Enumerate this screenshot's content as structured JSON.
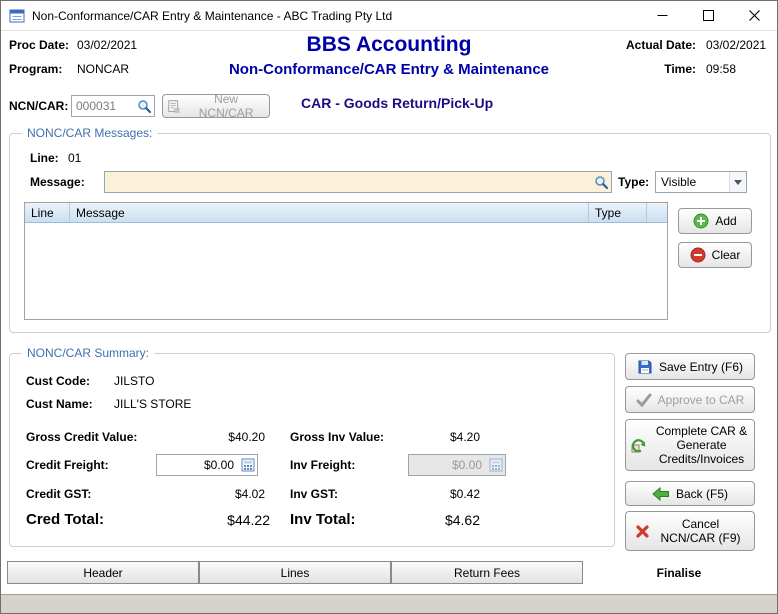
{
  "colors": {
    "heading_blue": "#0000a8",
    "group_title_blue": "#3f6fb0",
    "mode_text_navy": "#1b0c7f",
    "message_field_cream": "#fbf1d9",
    "add_green": "#57b947",
    "clear_red": "#d23a2e",
    "table_header_blue": "#cbdff1"
  },
  "window": {
    "title": "Non-Conformance/CAR Entry & Maintenance - ABC Trading Pty Ltd"
  },
  "header": {
    "proc_date_label": "Proc Date:",
    "proc_date": "03/02/2021",
    "program_label": "Program:",
    "program": "NONCAR",
    "app_title": "BBS Accounting",
    "app_subtitle": "Non-Conformance/CAR Entry & Maintenance",
    "actual_date_label": "Actual Date:",
    "actual_date": "03/02/2021",
    "time_label": "Time:",
    "time": "09:58"
  },
  "ncn": {
    "label": "NCN/CAR:",
    "value": "000031",
    "new_button_label": "New NCN/CAR",
    "mode_text": "CAR - Goods Return/Pick-Up"
  },
  "messages": {
    "group_title": "NONC/CAR Messages:",
    "line_label": "Line:",
    "line_value": "01",
    "message_label": "Message:",
    "message_value": "",
    "type_label": "Type:",
    "type_value": "Visible",
    "columns": [
      "Line",
      "Message",
      "Type"
    ],
    "rows": [],
    "add_label": "Add",
    "clear_label": "Clear"
  },
  "summary": {
    "group_title": "NONC/CAR Summary:",
    "cust_code_label": "Cust Code:",
    "cust_code": "JILSTO",
    "cust_name_label": "Cust Name:",
    "cust_name": "JILL'S STORE",
    "gross_credit_label": "Gross Credit Value:",
    "gross_credit_value": "$40.20",
    "gross_inv_label": "Gross Inv Value:",
    "gross_inv_value": "$4.20",
    "credit_freight_label": "Credit Freight:",
    "credit_freight_value": "$0.00",
    "inv_freight_label": "Inv Freight:",
    "inv_freight_value": "$0.00",
    "credit_gst_label": "Credit GST:",
    "credit_gst_value": "$4.02",
    "inv_gst_label": "Inv GST:",
    "inv_gst_value": "$0.42",
    "cred_total_label": "Cred Total:",
    "cred_total_value": "$44.22",
    "inv_total_label": "Inv Total:",
    "inv_total_value": "$4.62"
  },
  "actions": {
    "save": "Save Entry (F6)",
    "approve": "Approve to CAR",
    "complete": "Complete CAR & Generate Credits/Invoices",
    "back": "Back (F5)",
    "cancel": "Cancel NCN/CAR (F9)"
  },
  "tabs": [
    {
      "label": "Header",
      "active": false
    },
    {
      "label": "Lines",
      "active": false
    },
    {
      "label": "Return Fees",
      "active": false
    },
    {
      "label": "Finalise",
      "active": true
    }
  ]
}
